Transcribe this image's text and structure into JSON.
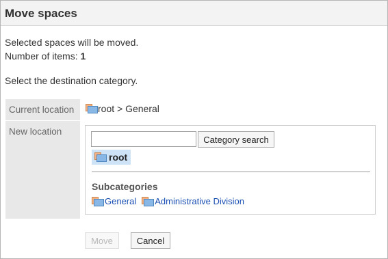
{
  "header": {
    "title": "Move spaces"
  },
  "intro": {
    "message": "Selected spaces will be moved.",
    "count_label": "Number of items:",
    "count_value": "1"
  },
  "prompt": "Select the destination category.",
  "current_location": {
    "label": "Current location",
    "path": "root > General"
  },
  "new_location": {
    "label": "New location",
    "search": {
      "value": "",
      "placeholder": ""
    },
    "search_button": "Category search",
    "selected_node": "root",
    "subcategories_heading": "Subcategories",
    "subcategories": [
      {
        "label": "General"
      },
      {
        "label": "Administrative Division"
      }
    ]
  },
  "actions": {
    "move": "Move",
    "cancel": "Cancel"
  },
  "colors": {
    "header_bg": "#f3f3f3",
    "label_bg": "#e8e8e8",
    "selected_bg": "#cfe3f7",
    "link": "#1a4fb3"
  }
}
